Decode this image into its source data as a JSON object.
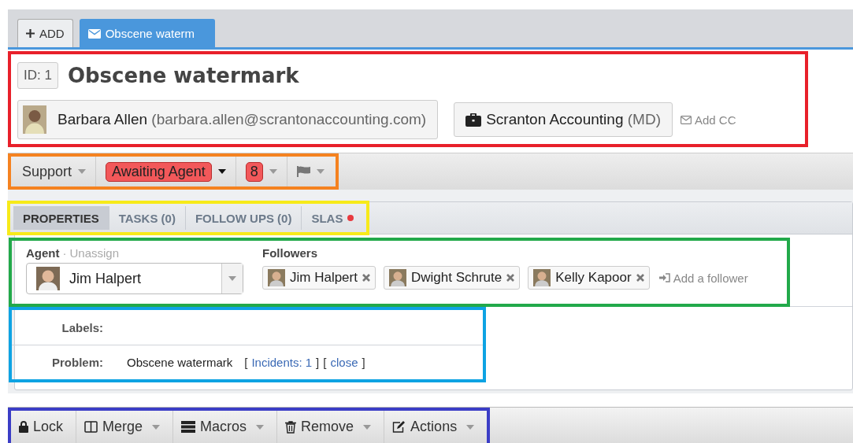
{
  "highlights": [
    {
      "color": "#e8202a"
    },
    {
      "color": "#f58220"
    },
    {
      "color": "#f7ea1a"
    },
    {
      "color": "#22a94a"
    },
    {
      "color": "#0ea3e3"
    },
    {
      "color": "#3b3dc6"
    }
  ],
  "tabs": [
    {
      "kind": "add",
      "label": "ADD",
      "selected": false
    },
    {
      "kind": "ticket",
      "label": "Obscene waterm",
      "selected": true
    }
  ],
  "header": {
    "id_label": "ID: 1",
    "subject": "Obscene watermark",
    "person_name": "Barbara Allen",
    "person_email": "(barbara.allen@scrantonaccounting.com)",
    "org_name": "Scranton Accounting",
    "org_code": "(MD)",
    "add_cc": "Add CC"
  },
  "status_bar": {
    "department": "Support",
    "status": "Awaiting Agent",
    "urgency": "8"
  },
  "subtabs": {
    "items": [
      {
        "label": "PROPERTIES",
        "selected": true,
        "alert": false
      },
      {
        "label": "TASKS (0)",
        "selected": false,
        "alert": false
      },
      {
        "label": "FOLLOW UPS (0)",
        "selected": false,
        "alert": false
      },
      {
        "label": "SLAS",
        "selected": false,
        "alert": true
      }
    ]
  },
  "people": {
    "agent_label": "Agent",
    "separator": "·",
    "unassign": "Unassign",
    "agent": "Jim Halpert",
    "followers_label": "Followers",
    "followers": [
      "Jim Halpert",
      "Dwight Schrute",
      "Kelly Kapoor"
    ],
    "add_follower": "Add a follower"
  },
  "fields": {
    "rows": [
      {
        "label": "Labels:",
        "value": "",
        "links": []
      },
      {
        "label": "Problem:",
        "value": "Obscene watermark",
        "links": [
          {
            "open": "[",
            "text": "Incidents: 1",
            "close": "]"
          },
          {
            "open": "[",
            "text": "close",
            "close": "]"
          }
        ]
      }
    ]
  },
  "actions": {
    "items": [
      {
        "kind": "lock",
        "label": "Lock",
        "caret": false
      },
      {
        "kind": "merge",
        "label": "Merge",
        "caret": true
      },
      {
        "kind": "macros",
        "label": "Macros",
        "caret": true
      },
      {
        "kind": "remove",
        "label": "Remove",
        "caret": true
      },
      {
        "kind": "actions",
        "label": "Actions",
        "caret": true
      }
    ]
  }
}
